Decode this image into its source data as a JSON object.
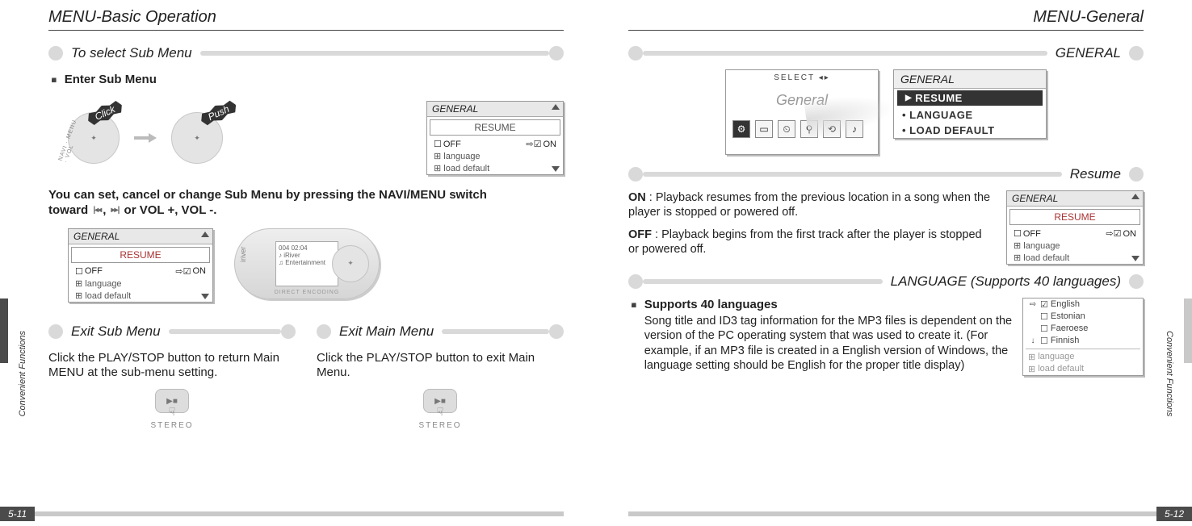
{
  "left": {
    "title": "MENU-Basic Operation",
    "sideLabel": "Convenient Functions",
    "pageNum": "5-11",
    "sec1": {
      "label": "To select Sub Menu"
    },
    "enterSubMenu": "Enter Sub Menu",
    "click": "Click",
    "push": "Push",
    "navArc": "NAVI · MENU · VOL",
    "lcd1": {
      "title": "GENERAL",
      "sel": "RESUME",
      "off": "OFF",
      "on": "ON",
      "row1": "language",
      "row2": "load default"
    },
    "bodyLine1a": "You can set, cancel or change Sub Menu by pressing the NAVI/MENU switch",
    "bodyLine1b_toward": "toward",
    "iconPrev": "|◂◂",
    "iconNext": "▸▸|",
    "bodyLine1c": " or VOL +, VOL -.",
    "device": {
      "brand": "iriver",
      "screenLine1": "004  02:04",
      "screenLine2": "♪ iRiver",
      "screenLine3": "♫ Entertainment",
      "enc": "DIRECT ENCODING"
    },
    "sec2": {
      "label": "Exit Sub Menu"
    },
    "sec3": {
      "label": "Exit Main Menu"
    },
    "exitSubText": "Click the PLAY/STOP button to return Main MENU at the sub-menu setting.",
    "exitMainText": "Click the PLAY/STOP button to exit Main Menu.",
    "stereo": "STEREO"
  },
  "right": {
    "title": "MENU-General",
    "sideLabel": "Convenient Functions",
    "pageNum": "5-12",
    "secGeneral": {
      "label": "GENERAL"
    },
    "iconLcd": {
      "top": "SELECT ◂▸",
      "big": "General"
    },
    "genLcd": {
      "title": "GENERAL",
      "item1": "RESUME",
      "item2": "LANGUAGE",
      "item3": "LOAD DEFAULT"
    },
    "secResume": {
      "label": "Resume"
    },
    "resumeOnLabel": "ON",
    "resumeOnText": " : Playback resumes from the previous location in a song when the player is stopped or powered off.",
    "resumeOffLabel": "OFF",
    "resumeOffText": " : Playback begins from the first track after the player is stopped or powered off.",
    "lcdResume": {
      "title": "GENERAL",
      "sel": "RESUME",
      "off": "OFF",
      "on": "ON",
      "row1": "language",
      "row2": "load default"
    },
    "secLang": {
      "label": "LANGUAGE (Supports 40 languages)"
    },
    "langHead": "Supports 40 languages",
    "langBody": "Song title and ID3 tag information for the MP3 files is dependent on the version of the PC operating system that was used to create it.  (For example, if an MP3 file is created in a English version of Windows, the language setting should be English for the proper title display)",
    "langLcd": {
      "l1": "English",
      "l2": "Estonian",
      "l3": "Faeroese",
      "l4": "Finnish",
      "row1": "language",
      "row2": "load default"
    }
  }
}
